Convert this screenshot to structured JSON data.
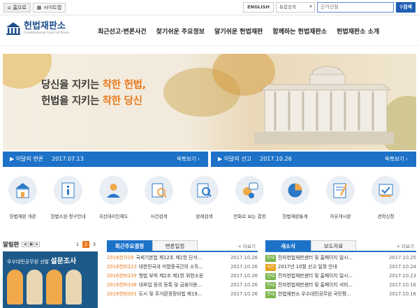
{
  "top": {
    "home": "홈으로",
    "sitemap": "사이트맵",
    "english": "ENGLISH",
    "search_scope": "통합검색",
    "search_value": "군가산점",
    "search_btn": "검색"
  },
  "logo": {
    "title": "헌법재판소",
    "sub": "Constitutional Court of Korea"
  },
  "nav": [
    "최근선고·변론사건",
    "찾기쉬운 주요정보",
    "알기쉬운 헌법재판",
    "함께하는 헌법재판소",
    "헌법재판소 소개"
  ],
  "hero": {
    "l1a": "당신을 지키는 ",
    "l1b": "착한 헌법,",
    "l2a": "헌법을 지키는 ",
    "l2b": "착한 당신"
  },
  "bars": [
    {
      "t": "▶ 이달의 변론",
      "d": "2017.07.13",
      "m": "목록보기 ›"
    },
    {
      "t": "▶ 이달의 선고",
      "d": "2017.10.26",
      "m": "목록보기 ›"
    }
  ],
  "icons": [
    "헌법재판 개관",
    "헌법소원 청구안내",
    "국선대리인제도",
    "사건검색",
    "판례검색",
    "만화로 보는 결정",
    "헌법재판통계",
    "자유게시판",
    "견학신청"
  ],
  "notice": {
    "title": "알림판",
    "pages": [
      "1",
      "2",
      "3"
    ],
    "survey_a": "우수대민공무원 선발 ",
    "survey_b": "설문조사"
  },
  "center": {
    "tab1": "최근주요결정",
    "tab2": "변론일정",
    "more": "+ 더보기",
    "rows": [
      {
        "c": "2016헌가19",
        "t": "국세기본법 제12조 제1항 단서...",
        "d": "2017.10.26"
      },
      {
        "c": "2016헌바223",
        "t": "대한민국과 미합중국간의 소득...",
        "d": "2017.10.26"
      },
      {
        "c": "2016헌바239",
        "t": "형법 부칙 제2조 제1항 위헌소원",
        "d": "2017.10.26"
      },
      {
        "c": "2016헌바338",
        "t": "대부업 등의 등록 및 금융이용...",
        "d": "2017.10.26"
      },
      {
        "c": "2016헌바301",
        "t": "도시 및 주거환경정비법 제19...",
        "d": "2017.10.26"
      }
    ]
  },
  "right": {
    "tab1": "새소식",
    "tab2": "보도자료",
    "more": "+ 더보기",
    "rows": [
      {
        "b": "안내",
        "bc": "#7ab54a",
        "t": "전자헌법재판센터 및 홈페이지 일시...",
        "d": "2017.10.25"
      },
      {
        "b": "사건",
        "bc": "#e8a21e",
        "t": "2017년 10월 선고 일정 안내",
        "d": "2017.10.24"
      },
      {
        "b": "안내",
        "bc": "#7ab54a",
        "t": "전자헌법재판센터 및 홈페이지 일시...",
        "d": "2017.10.23"
      },
      {
        "b": "안내",
        "bc": "#7ab54a",
        "t": "전자헌법재판센터 및 홈페이지 서비...",
        "d": "2017.10.16"
      },
      {
        "b": "안내",
        "bc": "#7ab54a",
        "t": "헌법재판소 우수대민공무원 국민평...",
        "d": "2017.10.16"
      }
    ]
  }
}
